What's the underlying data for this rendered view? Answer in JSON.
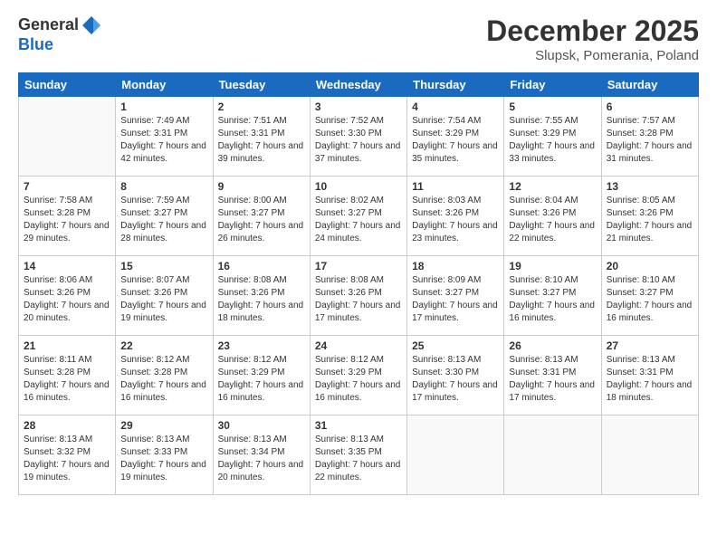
{
  "header": {
    "logo_general": "General",
    "logo_blue": "Blue",
    "month_title": "December 2025",
    "location": "Slupsk, Pomerania, Poland"
  },
  "days_of_week": [
    "Sunday",
    "Monday",
    "Tuesday",
    "Wednesday",
    "Thursday",
    "Friday",
    "Saturday"
  ],
  "weeks": [
    [
      {
        "day": "",
        "sunrise": "",
        "sunset": "",
        "daylight": ""
      },
      {
        "day": "1",
        "sunrise": "Sunrise: 7:49 AM",
        "sunset": "Sunset: 3:31 PM",
        "daylight": "Daylight: 7 hours and 42 minutes."
      },
      {
        "day": "2",
        "sunrise": "Sunrise: 7:51 AM",
        "sunset": "Sunset: 3:31 PM",
        "daylight": "Daylight: 7 hours and 39 minutes."
      },
      {
        "day": "3",
        "sunrise": "Sunrise: 7:52 AM",
        "sunset": "Sunset: 3:30 PM",
        "daylight": "Daylight: 7 hours and 37 minutes."
      },
      {
        "day": "4",
        "sunrise": "Sunrise: 7:54 AM",
        "sunset": "Sunset: 3:29 PM",
        "daylight": "Daylight: 7 hours and 35 minutes."
      },
      {
        "day": "5",
        "sunrise": "Sunrise: 7:55 AM",
        "sunset": "Sunset: 3:29 PM",
        "daylight": "Daylight: 7 hours and 33 minutes."
      },
      {
        "day": "6",
        "sunrise": "Sunrise: 7:57 AM",
        "sunset": "Sunset: 3:28 PM",
        "daylight": "Daylight: 7 hours and 31 minutes."
      }
    ],
    [
      {
        "day": "7",
        "sunrise": "Sunrise: 7:58 AM",
        "sunset": "Sunset: 3:28 PM",
        "daylight": "Daylight: 7 hours and 29 minutes."
      },
      {
        "day": "8",
        "sunrise": "Sunrise: 7:59 AM",
        "sunset": "Sunset: 3:27 PM",
        "daylight": "Daylight: 7 hours and 28 minutes."
      },
      {
        "day": "9",
        "sunrise": "Sunrise: 8:00 AM",
        "sunset": "Sunset: 3:27 PM",
        "daylight": "Daylight: 7 hours and 26 minutes."
      },
      {
        "day": "10",
        "sunrise": "Sunrise: 8:02 AM",
        "sunset": "Sunset: 3:27 PM",
        "daylight": "Daylight: 7 hours and 24 minutes."
      },
      {
        "day": "11",
        "sunrise": "Sunrise: 8:03 AM",
        "sunset": "Sunset: 3:26 PM",
        "daylight": "Daylight: 7 hours and 23 minutes."
      },
      {
        "day": "12",
        "sunrise": "Sunrise: 8:04 AM",
        "sunset": "Sunset: 3:26 PM",
        "daylight": "Daylight: 7 hours and 22 minutes."
      },
      {
        "day": "13",
        "sunrise": "Sunrise: 8:05 AM",
        "sunset": "Sunset: 3:26 PM",
        "daylight": "Daylight: 7 hours and 21 minutes."
      }
    ],
    [
      {
        "day": "14",
        "sunrise": "Sunrise: 8:06 AM",
        "sunset": "Sunset: 3:26 PM",
        "daylight": "Daylight: 7 hours and 20 minutes."
      },
      {
        "day": "15",
        "sunrise": "Sunrise: 8:07 AM",
        "sunset": "Sunset: 3:26 PM",
        "daylight": "Daylight: 7 hours and 19 minutes."
      },
      {
        "day": "16",
        "sunrise": "Sunrise: 8:08 AM",
        "sunset": "Sunset: 3:26 PM",
        "daylight": "Daylight: 7 hours and 18 minutes."
      },
      {
        "day": "17",
        "sunrise": "Sunrise: 8:08 AM",
        "sunset": "Sunset: 3:26 PM",
        "daylight": "Daylight: 7 hours and 17 minutes."
      },
      {
        "day": "18",
        "sunrise": "Sunrise: 8:09 AM",
        "sunset": "Sunset: 3:27 PM",
        "daylight": "Daylight: 7 hours and 17 minutes."
      },
      {
        "day": "19",
        "sunrise": "Sunrise: 8:10 AM",
        "sunset": "Sunset: 3:27 PM",
        "daylight": "Daylight: 7 hours and 16 minutes."
      },
      {
        "day": "20",
        "sunrise": "Sunrise: 8:10 AM",
        "sunset": "Sunset: 3:27 PM",
        "daylight": "Daylight: 7 hours and 16 minutes."
      }
    ],
    [
      {
        "day": "21",
        "sunrise": "Sunrise: 8:11 AM",
        "sunset": "Sunset: 3:28 PM",
        "daylight": "Daylight: 7 hours and 16 minutes."
      },
      {
        "day": "22",
        "sunrise": "Sunrise: 8:12 AM",
        "sunset": "Sunset: 3:28 PM",
        "daylight": "Daylight: 7 hours and 16 minutes."
      },
      {
        "day": "23",
        "sunrise": "Sunrise: 8:12 AM",
        "sunset": "Sunset: 3:29 PM",
        "daylight": "Daylight: 7 hours and 16 minutes."
      },
      {
        "day": "24",
        "sunrise": "Sunrise: 8:12 AM",
        "sunset": "Sunset: 3:29 PM",
        "daylight": "Daylight: 7 hours and 16 minutes."
      },
      {
        "day": "25",
        "sunrise": "Sunrise: 8:13 AM",
        "sunset": "Sunset: 3:30 PM",
        "daylight": "Daylight: 7 hours and 17 minutes."
      },
      {
        "day": "26",
        "sunrise": "Sunrise: 8:13 AM",
        "sunset": "Sunset: 3:31 PM",
        "daylight": "Daylight: 7 hours and 17 minutes."
      },
      {
        "day": "27",
        "sunrise": "Sunrise: 8:13 AM",
        "sunset": "Sunset: 3:31 PM",
        "daylight": "Daylight: 7 hours and 18 minutes."
      }
    ],
    [
      {
        "day": "28",
        "sunrise": "Sunrise: 8:13 AM",
        "sunset": "Sunset: 3:32 PM",
        "daylight": "Daylight: 7 hours and 19 minutes."
      },
      {
        "day": "29",
        "sunrise": "Sunrise: 8:13 AM",
        "sunset": "Sunset: 3:33 PM",
        "daylight": "Daylight: 7 hours and 19 minutes."
      },
      {
        "day": "30",
        "sunrise": "Sunrise: 8:13 AM",
        "sunset": "Sunset: 3:34 PM",
        "daylight": "Daylight: 7 hours and 20 minutes."
      },
      {
        "day": "31",
        "sunrise": "Sunrise: 8:13 AM",
        "sunset": "Sunset: 3:35 PM",
        "daylight": "Daylight: 7 hours and 22 minutes."
      },
      {
        "day": "",
        "sunrise": "",
        "sunset": "",
        "daylight": ""
      },
      {
        "day": "",
        "sunrise": "",
        "sunset": "",
        "daylight": ""
      },
      {
        "day": "",
        "sunrise": "",
        "sunset": "",
        "daylight": ""
      }
    ]
  ]
}
